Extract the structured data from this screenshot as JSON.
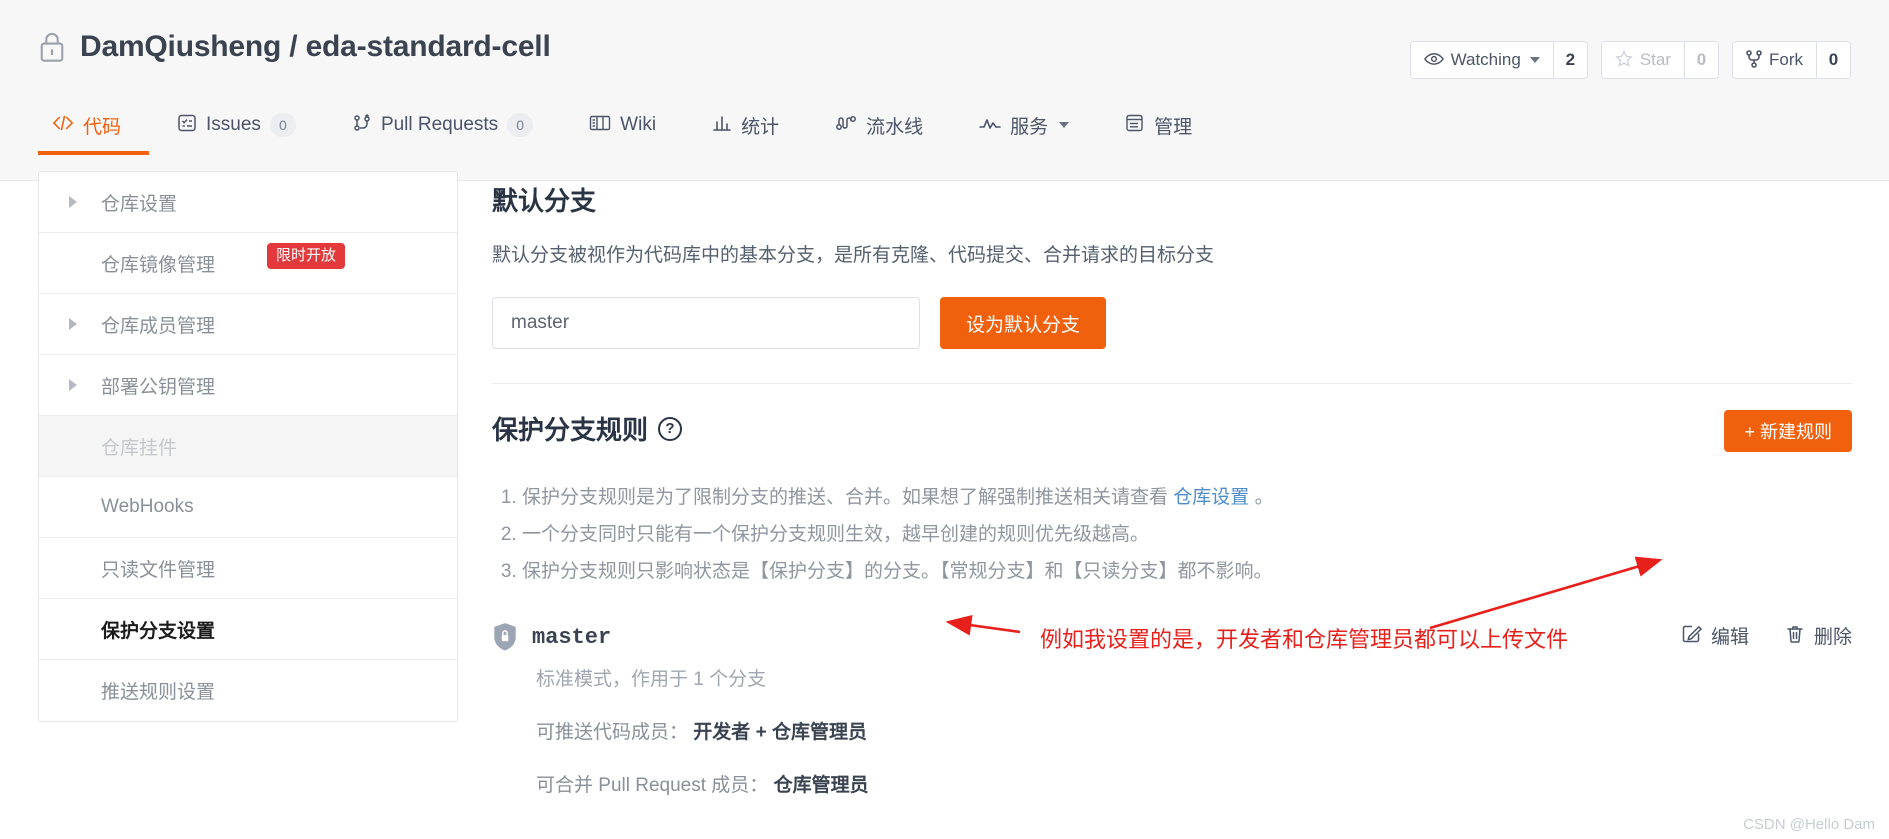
{
  "header": {
    "repo_owner": "DamQiusheng",
    "repo_separator": "/",
    "repo_name": "eda-standard-cell",
    "repo_full": "DamQiusheng / eda-standard-cell",
    "lock_icon": "lock-icon",
    "actions": [
      {
        "id": "watching",
        "icon": "eye-icon",
        "label": "Watching",
        "count": "2",
        "has_caret": true,
        "muted": false
      },
      {
        "id": "star",
        "icon": "star-icon",
        "label": "Star",
        "count": "0",
        "has_caret": false,
        "muted": true
      },
      {
        "id": "fork",
        "icon": "fork-icon",
        "label": "Fork",
        "count": "0",
        "has_caret": false,
        "muted": false
      }
    ]
  },
  "nav": {
    "items": [
      {
        "id": "code",
        "icon": "code-icon",
        "label": "代码",
        "badge": null,
        "active": true,
        "caret": false
      },
      {
        "id": "issues",
        "icon": "issues-icon",
        "label": "Issues",
        "badge": "0",
        "active": false,
        "caret": false
      },
      {
        "id": "pull-requests",
        "icon": "pull-request-icon",
        "label": "Pull Requests",
        "badge": "0",
        "active": false,
        "caret": false
      },
      {
        "id": "wiki",
        "icon": "book-icon",
        "label": "Wiki",
        "badge": null,
        "active": false,
        "caret": false
      },
      {
        "id": "stats",
        "icon": "chart-icon",
        "label": "统计",
        "badge": null,
        "active": false,
        "caret": false
      },
      {
        "id": "pipeline",
        "icon": "pipeline-icon",
        "label": "流水线",
        "badge": null,
        "active": false,
        "caret": false
      },
      {
        "id": "services",
        "icon": "pulse-icon",
        "label": "服务",
        "badge": null,
        "active": false,
        "caret": true
      },
      {
        "id": "manage",
        "icon": "manage-icon",
        "label": "管理",
        "badge": null,
        "active": false,
        "caret": false
      }
    ]
  },
  "sidebar": {
    "items": [
      {
        "id": "repo-settings",
        "label": "仓库设置",
        "arrow": true,
        "tag": null,
        "state": "normal"
      },
      {
        "id": "repo-mirror",
        "label": "仓库镜像管理",
        "arrow": false,
        "tag": "限时开放",
        "state": "normal"
      },
      {
        "id": "repo-members",
        "label": "仓库成员管理",
        "arrow": true,
        "tag": null,
        "state": "normal"
      },
      {
        "id": "deploy-keys",
        "label": "部署公钥管理",
        "arrow": true,
        "tag": null,
        "state": "normal"
      },
      {
        "id": "repo-widgets",
        "label": "仓库挂件",
        "arrow": false,
        "tag": null,
        "state": "disabled"
      },
      {
        "id": "webhooks",
        "label": "WebHooks",
        "arrow": false,
        "tag": null,
        "state": "normal"
      },
      {
        "id": "readonly-files",
        "label": "只读文件管理",
        "arrow": false,
        "tag": null,
        "state": "normal"
      },
      {
        "id": "protected-branch",
        "label": "保护分支设置",
        "arrow": false,
        "tag": null,
        "state": "current"
      },
      {
        "id": "push-rules",
        "label": "推送规则设置",
        "arrow": false,
        "tag": null,
        "state": "normal"
      }
    ]
  },
  "main": {
    "default_branch": {
      "title": "默认分支",
      "description": "默认分支被视作为代码库中的基本分支，是所有克隆、代码提交、合并请求的目标分支",
      "input_value": "master",
      "input_placeholder": "master",
      "submit_label": "设为默认分支"
    },
    "protect_rules": {
      "title": "保护分支规则",
      "help_icon": "question-mark-icon",
      "new_rule_label": "+ 新建规则",
      "notes": [
        {
          "text_before": "保护分支规则是为了限制分支的推送、合并。如果想了解强制推送相关请查看 ",
          "link": "仓库设置",
          "text_after": " 。"
        },
        {
          "text_before": "一个分支同时只能有一个保护分支规则生效，越早创建的规则优先级越高。",
          "link": null,
          "text_after": ""
        },
        {
          "text_before": "保护分支规则只影响状态是【保护分支】的分支。【常规分支】和【只读分支】都不影响。",
          "link": null,
          "text_after": ""
        }
      ]
    },
    "branch_entry": {
      "shield_icon": "shield-lock-icon",
      "name": "master",
      "mode": "标准模式，作用于 1 个分支",
      "push_label": "可推送代码成员：",
      "push_value": "开发者 + 仓库管理员",
      "merge_label": "可合并 Pull Request 成员：",
      "merge_value": "仓库管理员",
      "edit_label": "编辑",
      "edit_icon": "pencil-square-icon",
      "delete_label": "删除",
      "delete_icon": "trash-icon"
    }
  },
  "annotation": {
    "text": "例如我设置的是，开发者和仓库管理员都可以上传文件",
    "color": "#e8201c"
  },
  "watermark": "CSDN @Hello Dam",
  "colors": {
    "accent": "#f1600d",
    "tag_red": "#e4393c",
    "annotation_red": "#e8201c",
    "text_dark": "#3b4351",
    "text_muted": "#8a9099"
  }
}
